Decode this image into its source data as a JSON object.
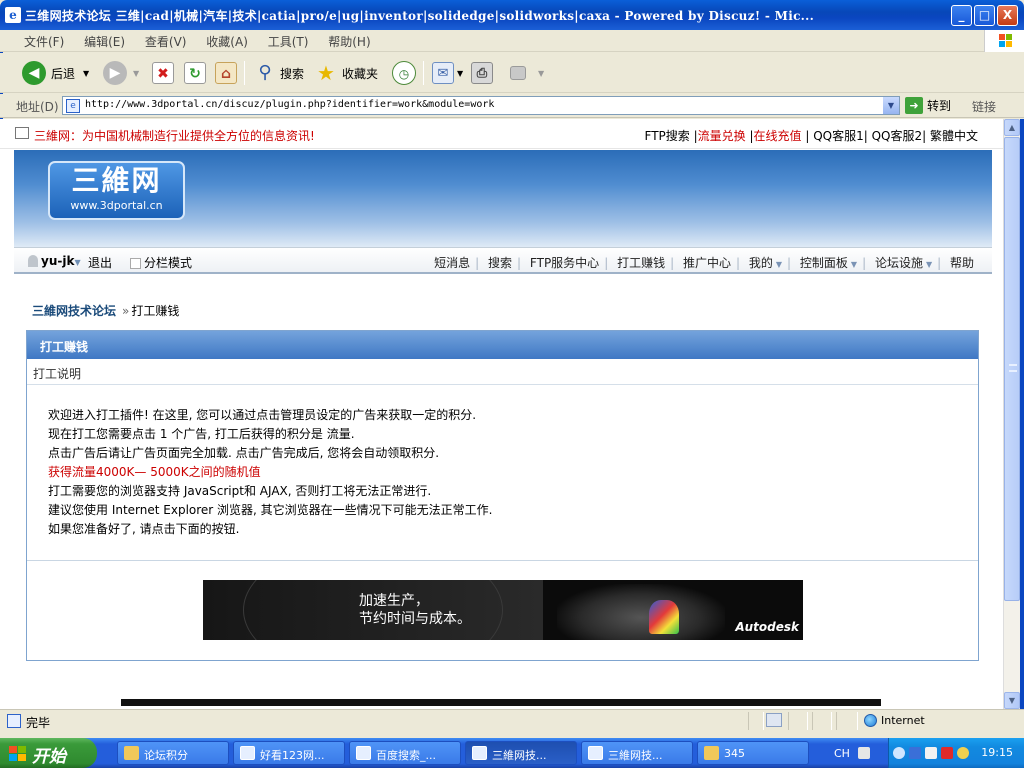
{
  "window": {
    "title": "三维网技术论坛 三维|cad|机械|汽车|技术|catia|pro/e|ug|inventor|solidedge|solidworks|caxa - Powered by Discuz! - Mic...",
    "minimize": "_",
    "maximize": "□",
    "close": "X"
  },
  "menu": [
    "文件(F)",
    "编辑(E)",
    "查看(V)",
    "收藏(A)",
    "工具(T)",
    "帮助(H)"
  ],
  "toolbar": {
    "back": "后退",
    "search": "搜索",
    "favorites": "收藏夹"
  },
  "address": {
    "label": "地址(D)",
    "url": "http://www.3dportal.cn/discuz/plugin.php?identifier=work&module=work",
    "go": "转到",
    "links": "链接"
  },
  "site": {
    "slogan": "三維网：为中国机械制造行业提供全方位的信息资讯!",
    "top_links": {
      "ftp_search": "FTP搜索",
      "traffic": "流量兑换",
      "recharge": "在线充值",
      "qq1": "QQ客服1",
      "qq2": "QQ客服2",
      "traditional": "繁體中文"
    },
    "logo_big": "三維网",
    "logo_small": "www.3dportal.cn"
  },
  "nav": {
    "user": "yu-jk",
    "logout": "退出",
    "split_mode": "分栏模式",
    "items": [
      "短消息",
      "搜索",
      "FTP服务中心",
      "打工赚钱",
      "推广中心",
      "我的",
      "控制面板",
      "论坛设施",
      "帮助"
    ]
  },
  "breadcrumb": {
    "home": "三維网技术论坛",
    "separator": "»",
    "current": "打工赚钱"
  },
  "panel": {
    "title": "打工赚钱",
    "subtitle": "打工说明",
    "lines": [
      "欢迎进入打工插件! 在这里, 您可以通过点击管理员设定的广告来获取一定的积分.",
      "现在打工您需要点击  1 个广告, 打工后获得的积分是  流量.",
      "点击广告后请让广告页面完全加载. 点击广告完成后, 您将会自动领取积分.",
      "获得流量4000K— 5000K之间的随机值",
      "打工需要您的浏览器支持  JavaScript和  AJAX, 否则打工将无法正常进行.",
      "建议您使用  Internet Explorer 浏览器, 其它浏览器在一些情况下可能无法正常工作.",
      "如果您准备好了, 请点击下面的按钮."
    ]
  },
  "ad": {
    "line1": "加速生产，",
    "line2": "节约时间与成本。",
    "brand": "Autodesk"
  },
  "status": {
    "done": "完毕",
    "zone": "Internet"
  },
  "taskbar": {
    "start": "开始",
    "tasks": [
      "论坛积分",
      "好看123网...",
      "百度搜索_...",
      "三維网技...",
      "三維网技...",
      "345"
    ],
    "lang": "CH",
    "clock": "19:15"
  }
}
